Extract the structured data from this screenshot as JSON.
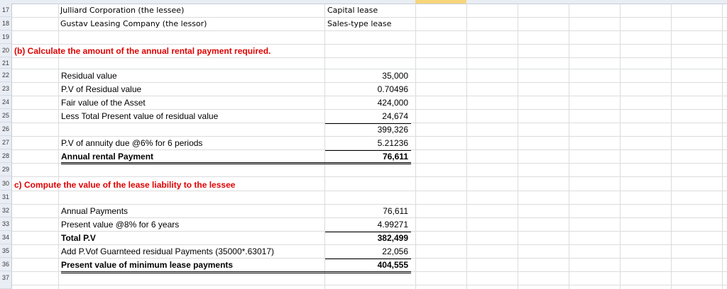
{
  "rows": [
    "17",
    "18",
    "19",
    "20",
    "21",
    "22",
    "23",
    "24",
    "25",
    "26",
    "27",
    "28",
    "29",
    "30",
    "31",
    "32",
    "33",
    "34",
    "35",
    "36",
    "37"
  ],
  "header": {
    "r17_label": "Julliard Corporation (the lessee)",
    "r17_value": "Capital lease",
    "r18_label": "Gustav Leasing Company (the lessor)",
    "r18_value": "Sales-type lease"
  },
  "section_b": {
    "title": "(b) Calculate the amount of the annual rental payment required.",
    "lines": [
      {
        "label": "Residual value",
        "value": "35,000"
      },
      {
        "label": "P.V of Residual value",
        "value": "0.70496"
      },
      {
        "label": "Fair value of the Asset",
        "value": "424,000"
      },
      {
        "label": "Less Total Present value of residual value",
        "value": "24,674"
      },
      {
        "label": "",
        "value": "399,326"
      },
      {
        "label": "P.V of annuity due @6% for 6 periods",
        "value": "5.21236"
      },
      {
        "label": "Annual rental Payment",
        "value": "76,611"
      }
    ]
  },
  "section_c": {
    "title": "c) Compute the value of the lease liability to the lessee",
    "lines": [
      {
        "label": "Annual  Payments",
        "value": "76,611"
      },
      {
        "label": "Present value @8% for 6 years",
        "value": "4.99271"
      },
      {
        "label": "Total P.V",
        "value": "382,499"
      },
      {
        "label": "Add P.Vof Guarnteed residual Payments (35000*.63017)",
        "value": "22,056"
      },
      {
        "label": "Present value of minimum lease payments",
        "value": "404,555"
      }
    ]
  }
}
